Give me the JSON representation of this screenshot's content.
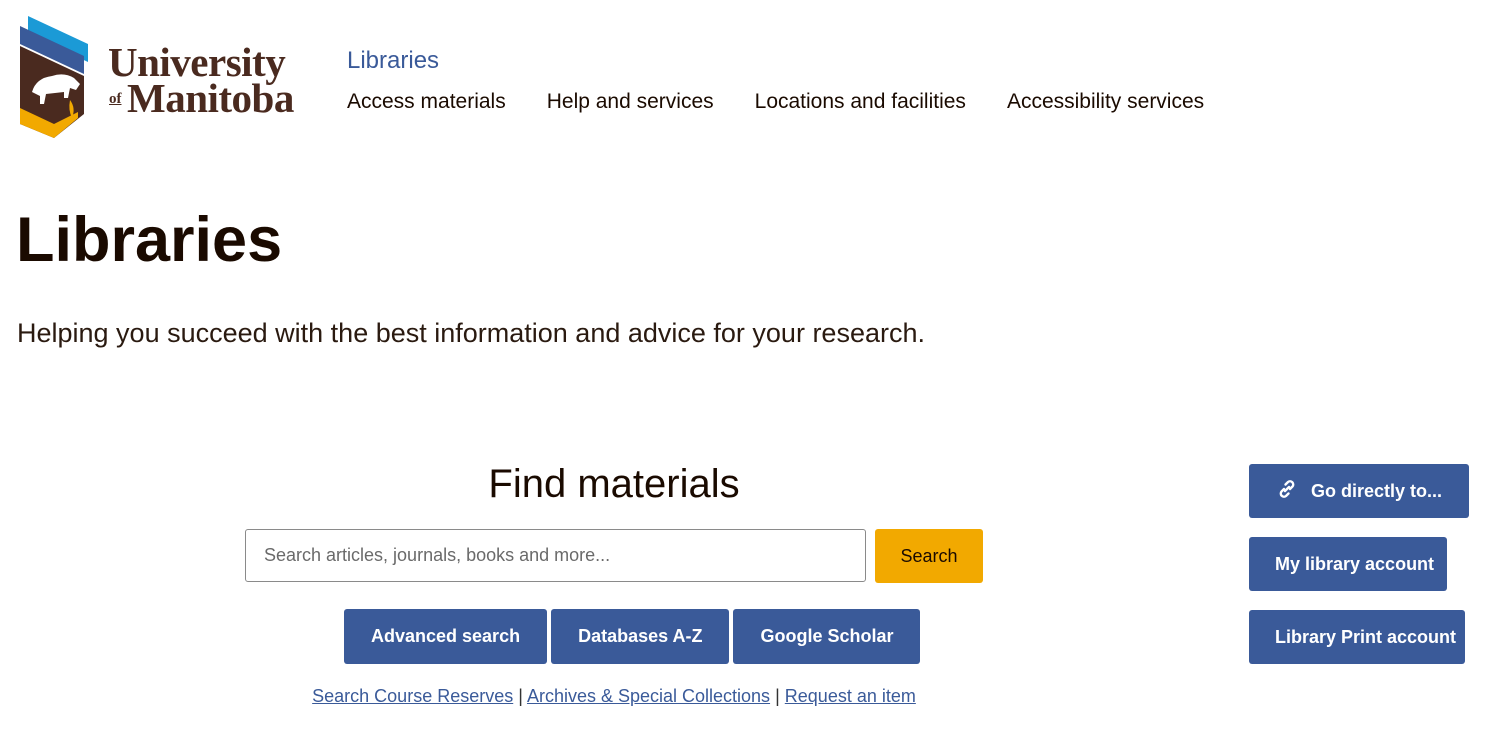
{
  "branding": {
    "logo_line1": "University",
    "logo_of": "of",
    "logo_line2": "Manitoba",
    "colors": {
      "brown": "#4a2a1f",
      "blue_light": "#1b9ad6",
      "blue_dark": "#3a5a99",
      "gold": "#f2a900"
    }
  },
  "header": {
    "site_name": "Libraries",
    "nav": [
      "Access materials",
      "Help and services",
      "Locations and facilities",
      "Accessibility services"
    ]
  },
  "hero": {
    "title": "Libraries",
    "lead": "Helping you succeed with the best information and advice for your research."
  },
  "find": {
    "heading": "Find materials",
    "search_placeholder": "Search articles, journals, books and more...",
    "search_button": "Search",
    "quick_buttons": [
      "Advanced search",
      "Databases A-Z",
      "Google Scholar"
    ],
    "links": [
      "Search Course Reserves",
      "Archives & Special Collections",
      "Request an item"
    ],
    "separator": "|"
  },
  "side": {
    "go_directly": "Go directly to...",
    "go_directly_icon": "link-icon",
    "my_account": "My library account",
    "print_account": "Library Print account"
  }
}
